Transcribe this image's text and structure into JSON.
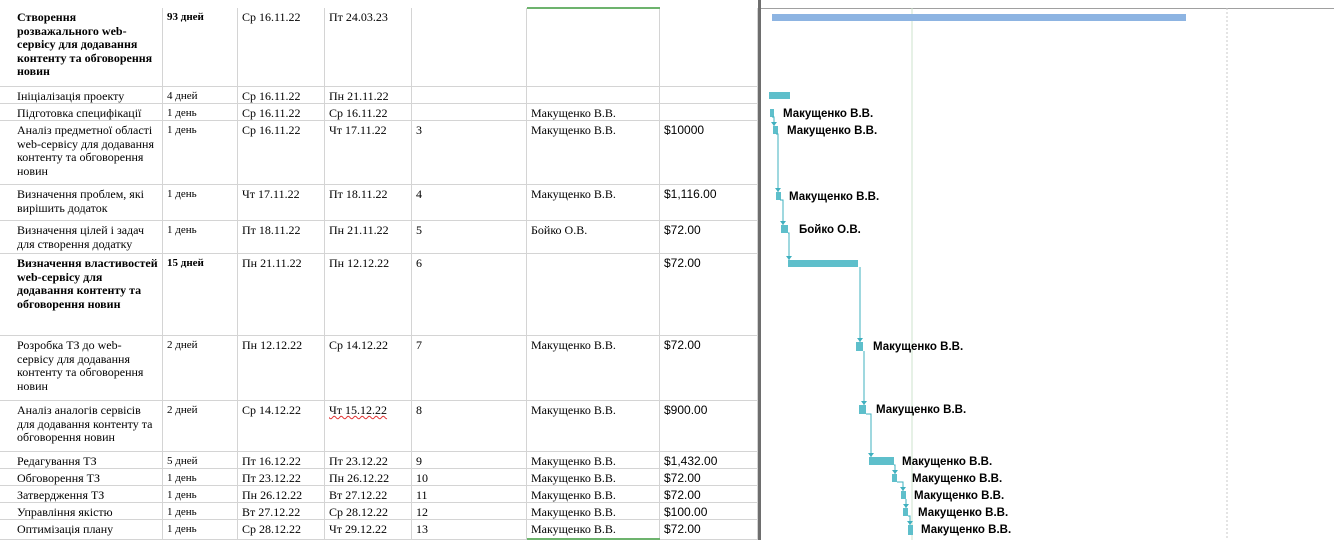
{
  "tasks": [
    {
      "name": "Створення розважального web-сервісу для додавання контенту та обговорення новин",
      "duration": "93 дней",
      "start": "Ср 16.11.22",
      "finish": "Пт 24.03.23",
      "pred": "",
      "resource": "",
      "cost": "",
      "summary": true
    },
    {
      "name": "Ініціалізація проекту",
      "duration": "4 дней",
      "start": "Ср 16.11.22",
      "finish": "Пн 21.11.22",
      "pred": "",
      "resource": "",
      "cost": "",
      "summary": false
    },
    {
      "name": "Підготовка специфікації",
      "duration": "1 день",
      "start": "Ср 16.11.22",
      "finish": "Ср 16.11.22",
      "pred": "",
      "resource": "Макущенко В.В.",
      "cost": "",
      "summary": false
    },
    {
      "name": "Аналіз предметної області web-сервісу для додавання контенту та обговорення новин",
      "duration": "1 день",
      "start": "Ср 16.11.22",
      "finish": "Чт 17.11.22",
      "pred": "3",
      "resource": "Макущенко В.В.",
      "cost": "$10000",
      "summary": false
    },
    {
      "name": "Визначення проблем, які вирішить додаток",
      "duration": "1 день",
      "start": "Чт 17.11.22",
      "finish": "Пт 18.11.22",
      "pred": "4",
      "resource": "Макущенко В.В.",
      "cost": "$1,116.00",
      "summary": false
    },
    {
      "name": "Визначення цілей і задач для створення додатку",
      "duration": "1 день",
      "start": "Пт 18.11.22",
      "finish": "Пн 21.11.22",
      "pred": "5",
      "resource": "Бойко О.В.",
      "cost": "$72.00",
      "summary": false
    },
    {
      "name": "Визначення властивостей web-сервісу для додавання контенту та обговорення новин",
      "duration": "15 дней",
      "start": "Пн 21.11.22",
      "finish": "Пн 12.12.22",
      "pred": "6",
      "resource": "",
      "cost": "$72.00",
      "summary": true
    },
    {
      "name": "Розробка ТЗ до web-сервісу для додавання контенту та обговорення новин",
      "duration": "2 дней",
      "start": "Пн 12.12.22",
      "finish": "Ср 14.12.22",
      "pred": "7",
      "resource": "Макущенко В.В.",
      "cost": "$72.00",
      "summary": false
    },
    {
      "name": "Аналіз аналогів сервісів для додавання контенту та обговорення новин",
      "duration": "2 дней",
      "start": "Ср 14.12.22",
      "finish": "Чт 15.12.22",
      "pred": "8",
      "resource": "Макущенко В.В.",
      "cost": "$900.00",
      "summary": false
    },
    {
      "name": "Редагування ТЗ",
      "duration": "5 дней",
      "start": "Пт 16.12.22",
      "finish": "Пт 23.12.22",
      "pred": "9",
      "resource": "Макущенко В.В.",
      "cost": "$1,432.00",
      "summary": false
    },
    {
      "name": "Обговорення ТЗ",
      "duration": "1 день",
      "start": "Пт 23.12.22",
      "finish": "Пн 26.12.22",
      "pred": "10",
      "resource": "Макущенко В.В.",
      "cost": "$72.00",
      "summary": false
    },
    {
      "name": "Затвердження ТЗ",
      "duration": "1 день",
      "start": "Пн 26.12.22",
      "finish": "Вт 27.12.22",
      "pred": "11",
      "resource": "Макущенко В.В.",
      "cost": "$72.00",
      "summary": false
    },
    {
      "name": "Управління якістю",
      "duration": "1 день",
      "start": "Вт 27.12.22",
      "finish": "Ср 28.12.22",
      "pred": "12",
      "resource": "Макущенко В.В.",
      "cost": "$100.00",
      "summary": false
    },
    {
      "name": "Оптимізація плану",
      "duration": "1 день",
      "start": "Ср 28.12.22",
      "finish": "Чт 29.12.22",
      "pred": "13",
      "resource": "Макущенко В.В.",
      "cost": "$72.00",
      "summary": false
    }
  ],
  "gantt": {
    "labels": [
      "Макущенко В.В.",
      "Макущенко В.В.",
      "Макущенко В.В.",
      "Бойко О.В.",
      "Макущенко В.В.",
      "Макущенко В.В.",
      "Макущенко В.В.",
      "Макущенко В.В.",
      "Макущенко В.В.",
      "Макущенко В.В.",
      "Макущенко В.В."
    ],
    "colors": {
      "summary_bar": "#8db4e2",
      "task_bar": "#5ebfcb",
      "link_line": "#3fb0bf",
      "gridline": "#cde3cd"
    }
  }
}
